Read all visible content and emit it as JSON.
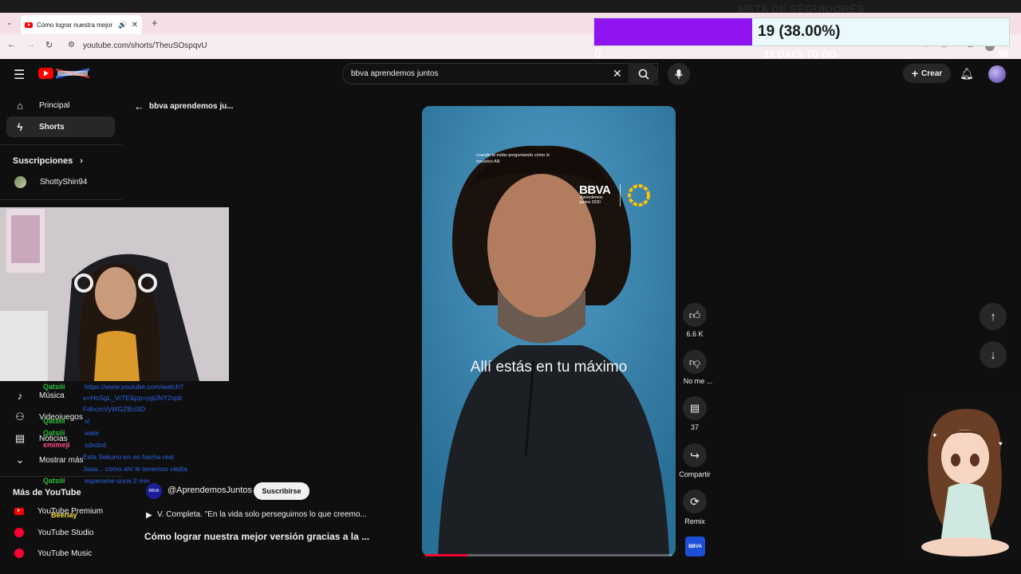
{
  "browser": {
    "tab_title": "Cómo lograr nuestra mejor",
    "url": "youtube.com/shorts/TheuSOspqvU"
  },
  "overlay_goal": {
    "title": "META DE SEGUIDORES",
    "progress_text": "19 (38.00%)",
    "progress_fraction": 0.38,
    "min": "0",
    "max": "50",
    "days_left": "12 DAYS TO GO",
    "fill_color": "#8f14f0"
  },
  "header": {
    "search_value": "bbva aprendemos juntos",
    "create_label": "Crear"
  },
  "sidebar": {
    "items_top": [
      {
        "label": "Principal",
        "icon": "home-icon"
      },
      {
        "label": "Shorts",
        "icon": "shorts-icon"
      }
    ],
    "subscriptions_heading": "Suscripciones",
    "subscriptions": [
      {
        "label": "ShottyShin94"
      }
    ],
    "explore_items": [
      {
        "label": "Música",
        "icon": "music-icon"
      },
      {
        "label": "Videojuegos",
        "icon": "gaming-icon"
      },
      {
        "label": "Noticias",
        "icon": "news-icon"
      },
      {
        "label": "Mostrar más",
        "icon": "chevron-down-icon"
      }
    ],
    "more_heading": "Más de YouTube",
    "more_items": [
      {
        "label": "YouTube Premium"
      },
      {
        "label": "YouTube Studio"
      },
      {
        "label": "YouTube Music"
      }
    ]
  },
  "back_query": "bbva aprendemos ju...",
  "chat": [
    {
      "name": "Qatsiii",
      "message": "https://www.youtube.com/watch?",
      "color": "#2fbf3a"
    },
    {
      "name": "",
      "message": "v=HoSgL_VrTE&pp=ygUNY2xpb",
      "color": ""
    },
    {
      "name": "",
      "message": "FdhcmVyWGZBcl3D",
      "color": ""
    },
    {
      "name": "Qatsiii",
      "message": "si",
      "color": "#2fbf3a"
    },
    {
      "name": "Qatsiii",
      "message": "wate",
      "color": "#2fbf3a"
    },
    {
      "name": "emimeji",
      "message": "xdxdxd",
      "color": "#ff4a8a"
    },
    {
      "name": "",
      "message": "Esta Sekuno en en hacha real",
      "color": ""
    },
    {
      "name": "",
      "message": "Jaaa... como ahí le tenemos viejita",
      "color": ""
    },
    {
      "name": "Qatsiii",
      "message": "esperame unos 2 min",
      "color": "#2fbf3a"
    },
    {
      "name": "Beerlay",
      "message": "",
      "color": "#f5e04c"
    }
  ],
  "video": {
    "corner_text": "cuando te estás preguntando cómo lo resuelvo Allí",
    "brand": "BBVA",
    "brand_sub": "Aprendemos juntos 2030",
    "caption": "Allí estás en tu máximo",
    "progress_fraction": 0.17,
    "channel": "@AprendemosJuntos",
    "subscribe_label": "Suscribirse",
    "description": "V. Completa. \"En la vida solo perseguimos lo que creemo...",
    "title": "Cómo lograr nuestra mejor versión gracias a la ..."
  },
  "actions": {
    "likes": "6.6 K",
    "dislike": "No me ...",
    "comments": "37",
    "share": "Compartir",
    "remix": "Remix"
  },
  "bbva_badge": "BBVA"
}
